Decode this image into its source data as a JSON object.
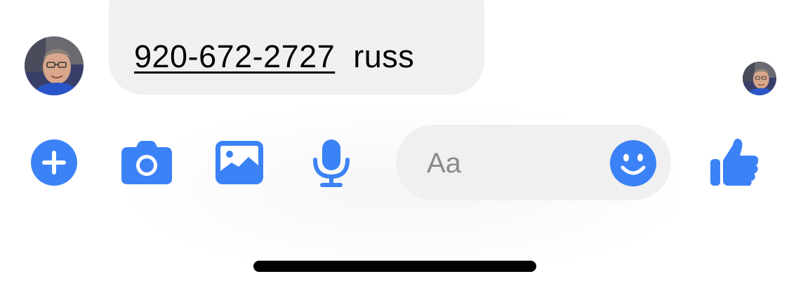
{
  "message": {
    "phone": "920-672-2727",
    "name": "russ"
  },
  "sender_avatar": {
    "icon": "user-avatar"
  },
  "read_receipt": {
    "icon": "read-receipt-avatar"
  },
  "toolbar": {
    "plus_icon": "plus-circle-icon",
    "camera_icon": "camera-icon",
    "gallery_icon": "image-icon",
    "mic_icon": "microphone-icon",
    "like_icon": "thumbs-up-icon"
  },
  "composer": {
    "placeholder": "Aa",
    "emoji_icon": "smiley-icon"
  },
  "colors": {
    "accent": "#3b82f6",
    "bubble": "#f0f0f0",
    "text": "#000000",
    "placeholder": "#8a8a8e"
  }
}
